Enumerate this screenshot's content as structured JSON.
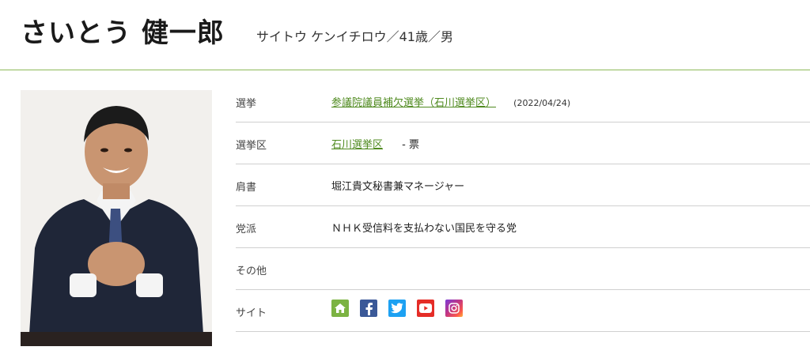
{
  "header": {
    "name": "さいとう 健一郎",
    "kana_info": "サイトウ ケンイチロウ／41歳／男"
  },
  "profile": {
    "rows": [
      {
        "label": "選挙",
        "link": "参議院議員補欠選挙（石川選挙区）",
        "date": "(2022/04/24)"
      },
      {
        "label": "選挙区",
        "link": "石川選挙区",
        "votes": "- 票"
      },
      {
        "label": "肩書",
        "value": "堀江貴文秘書兼マネージャー"
      },
      {
        "label": "党派",
        "value": "ＮＨＫ受信料を支払わない国民を守る党"
      },
      {
        "label": "その他",
        "value": ""
      },
      {
        "label": "サイト"
      }
    ],
    "site_icons": [
      {
        "name": "home-icon",
        "color": "#7cb342"
      },
      {
        "name": "facebook-icon",
        "color": "#3b5998"
      },
      {
        "name": "twitter-icon",
        "color": "#1da1f2"
      },
      {
        "name": "youtube-icon",
        "color": "#e52d27"
      },
      {
        "name": "instagram-icon",
        "color": "#c13584"
      }
    ]
  },
  "colors": {
    "accent_green": "#4f8a1f",
    "divider_green": "#8dba5a"
  }
}
